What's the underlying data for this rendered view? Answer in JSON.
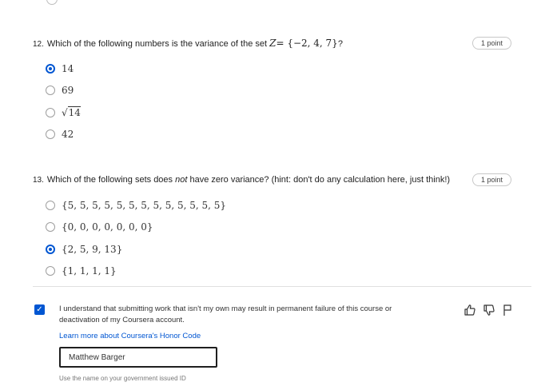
{
  "questions": [
    {
      "number": "12.",
      "text_prefix": "Which of the following numbers is the variance of the set",
      "math_var": "Z",
      "math_set": " = {−2, 4, 7}",
      "text_suffix": "?",
      "points": "1 point",
      "options": [
        {
          "label": "14",
          "checked": true
        },
        {
          "label": "69",
          "checked": false
        },
        {
          "label": "14",
          "sqrt": true,
          "checked": false
        },
        {
          "label": "42",
          "checked": false
        }
      ]
    },
    {
      "number": "13.",
      "text_prefix": "Which of the following sets does",
      "emphasis": "not",
      "text_suffix": "have zero variance? (hint: don't do any calculation here, just think!)",
      "points": "1 point",
      "options": [
        {
          "label": "{5, 5, 5, 5, 5, 5, 5, 5, 5, 5, 5, 5, 5}",
          "checked": false
        },
        {
          "label": "{0, 0, 0, 0, 0, 0, 0}",
          "checked": false
        },
        {
          "label": "{2, 5, 9, 13}",
          "checked": true
        },
        {
          "label": "{1, 1, 1, 1}",
          "checked": false
        }
      ]
    }
  ],
  "honor": {
    "checked": true,
    "statement": "I understand that submitting work that isn't my own may result in permanent failure of this course or deactivation of my Coursera account.",
    "link": "Learn more about Coursera's Honor Code",
    "name_value": "Matthew Barger",
    "hint": "Use the name on your government issued ID"
  },
  "icons": [
    "thumbs-up-icon",
    "thumbs-down-icon",
    "flag-icon"
  ],
  "colors": {
    "accent": "#0056d2",
    "divider": "#e0e0e0"
  }
}
